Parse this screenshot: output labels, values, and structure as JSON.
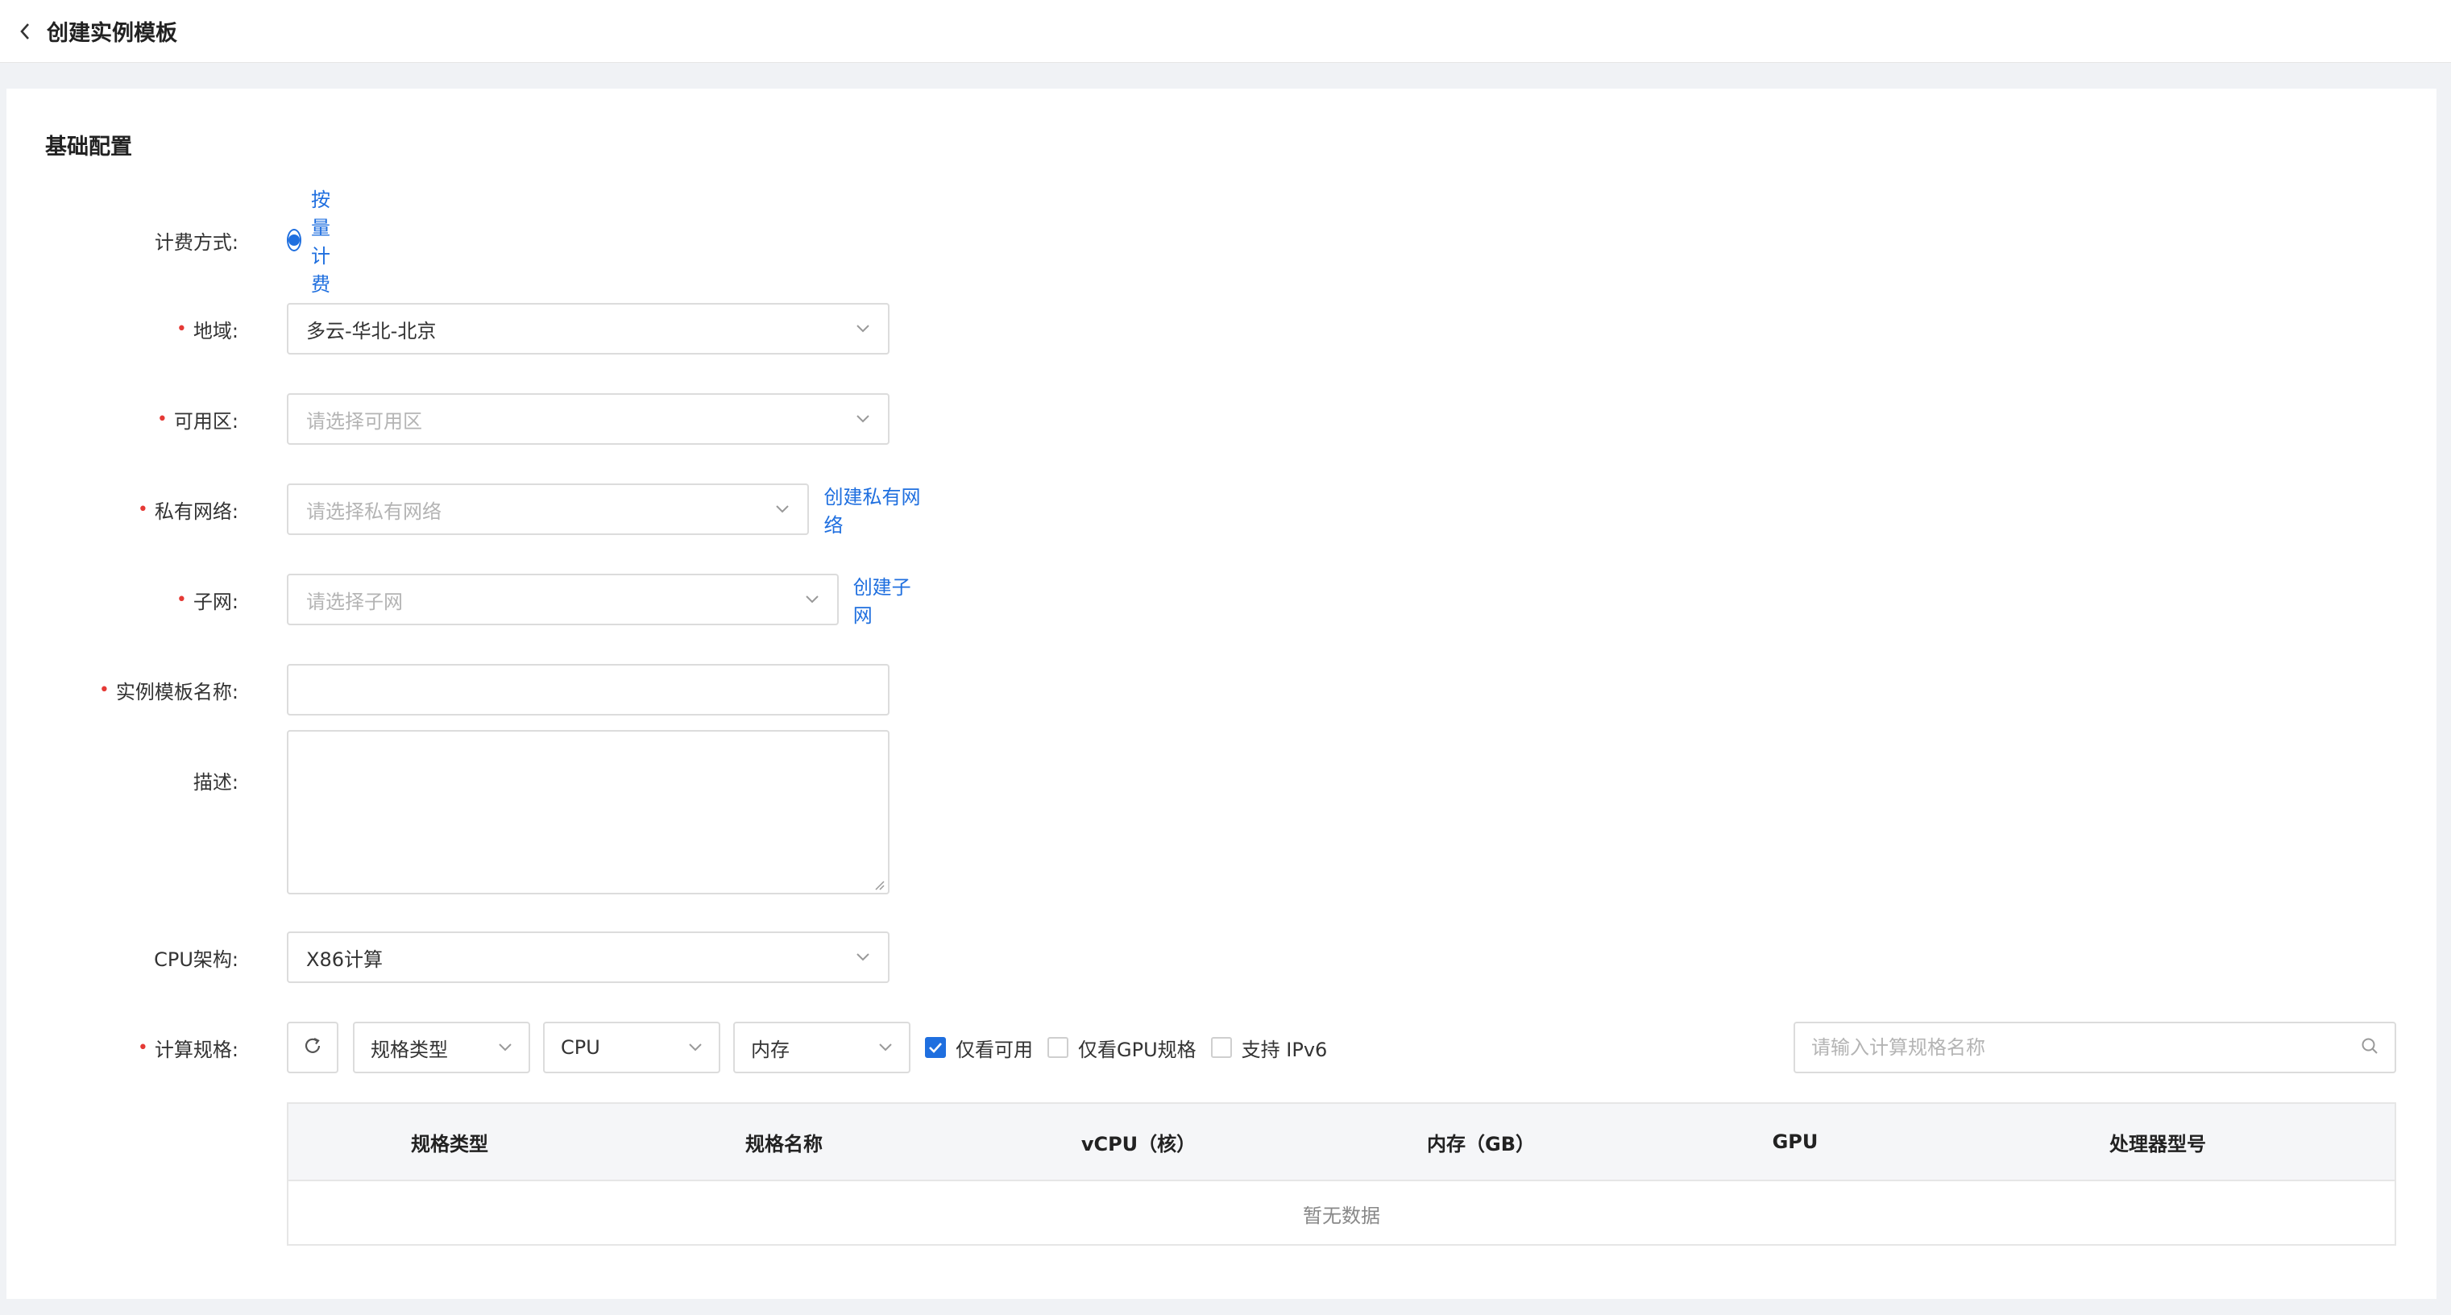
{
  "header": {
    "title": "创建实例模板"
  },
  "section": {
    "title": "基础配置"
  },
  "form": {
    "billing": {
      "label": "计费方式:",
      "option": "按量计费"
    },
    "region": {
      "label": "地域:",
      "value": "多云-华北-北京"
    },
    "zone": {
      "label": "可用区:",
      "placeholder": "请选择可用区"
    },
    "vpc": {
      "label": "私有网络:",
      "placeholder": "请选择私有网络",
      "link": "创建私有网络"
    },
    "subnet": {
      "label": "子网:",
      "placeholder": "请选择子网",
      "link": "创建子网"
    },
    "template_name": {
      "label": "实例模板名称:",
      "value": ""
    },
    "description": {
      "label": "描述:",
      "value": ""
    },
    "cpu_arch": {
      "label": "CPU架构:",
      "value": "X86计算"
    },
    "compute_spec": {
      "label": "计算规格:",
      "filters": {
        "type": "规格类型",
        "cpu": "CPU",
        "memory": "内存"
      },
      "checkboxes": {
        "available_only": {
          "label": "仅看可用",
          "checked": true
        },
        "gpu_only": {
          "label": "仅看GPU规格",
          "checked": false
        },
        "ipv6": {
          "label": "支持 IPv6",
          "checked": false
        }
      },
      "search_placeholder": "请输入计算规格名称"
    }
  },
  "table": {
    "columns": [
      "规格类型",
      "规格名称",
      "vCPU（核）",
      "内存（GB）",
      "GPU",
      "处理器型号"
    ],
    "empty_text": "暂无数据"
  },
  "colors": {
    "accent": "#1f6fdf",
    "required": "#e53935",
    "border": "#dcdcdc"
  }
}
